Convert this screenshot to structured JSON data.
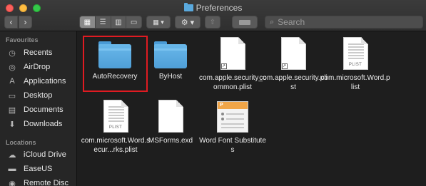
{
  "window": {
    "title": "Preferences",
    "search_placeholder": "Search"
  },
  "toolbar": {
    "back_label": "‹",
    "forward_label": "›",
    "view_icons": [
      "▦",
      "☰",
      "▥",
      "▭"
    ],
    "group_label": "▦ ▾",
    "action_label": "⚙ ▾",
    "share_label": "⇧"
  },
  "sidebar": {
    "favourites_heading": "Favourites",
    "favourites": [
      {
        "label": "Recents",
        "icon": "clock-icon",
        "glyph": "◷"
      },
      {
        "label": "AirDrop",
        "icon": "airdrop-icon",
        "glyph": "◎"
      },
      {
        "label": "Applications",
        "icon": "applications-icon",
        "glyph": "A"
      },
      {
        "label": "Desktop",
        "icon": "desktop-icon",
        "glyph": "▭"
      },
      {
        "label": "Documents",
        "icon": "documents-icon",
        "glyph": "▤"
      },
      {
        "label": "Downloads",
        "icon": "downloads-icon",
        "glyph": "⬇"
      }
    ],
    "locations_heading": "Locations",
    "locations": [
      {
        "label": "iCloud Drive",
        "icon": "cloud-icon",
        "glyph": "☁"
      },
      {
        "label": "EaseUS",
        "icon": "disk-icon",
        "glyph": "▬"
      },
      {
        "label": "Remote Disc",
        "icon": "disc-icon",
        "glyph": "◉"
      }
    ]
  },
  "files": [
    {
      "name": "AutoRecovery",
      "kind": "folder",
      "selected": true
    },
    {
      "name": "ByHost",
      "kind": "folder"
    },
    {
      "name": "com.apple.security_common.plist",
      "kind": "blank-alias"
    },
    {
      "name": "com.apple.security.plist",
      "kind": "blank-alias"
    },
    {
      "name": "com.microsoft.Word.plist",
      "kind": "plist",
      "badge": "PLIST"
    },
    {
      "name": "com.microsoft.Word.secur...rks.plist",
      "kind": "plist",
      "badge": "PLIST"
    },
    {
      "name": "MSForms.exd",
      "kind": "blank"
    },
    {
      "name": "Word Font Substitutes",
      "kind": "wordfont"
    }
  ],
  "colors": {
    "folder_blue": "#5aa9dd",
    "selection_border": "#e01b22",
    "window_bg": "#1e1e1e",
    "sidebar_bg": "#262626"
  }
}
